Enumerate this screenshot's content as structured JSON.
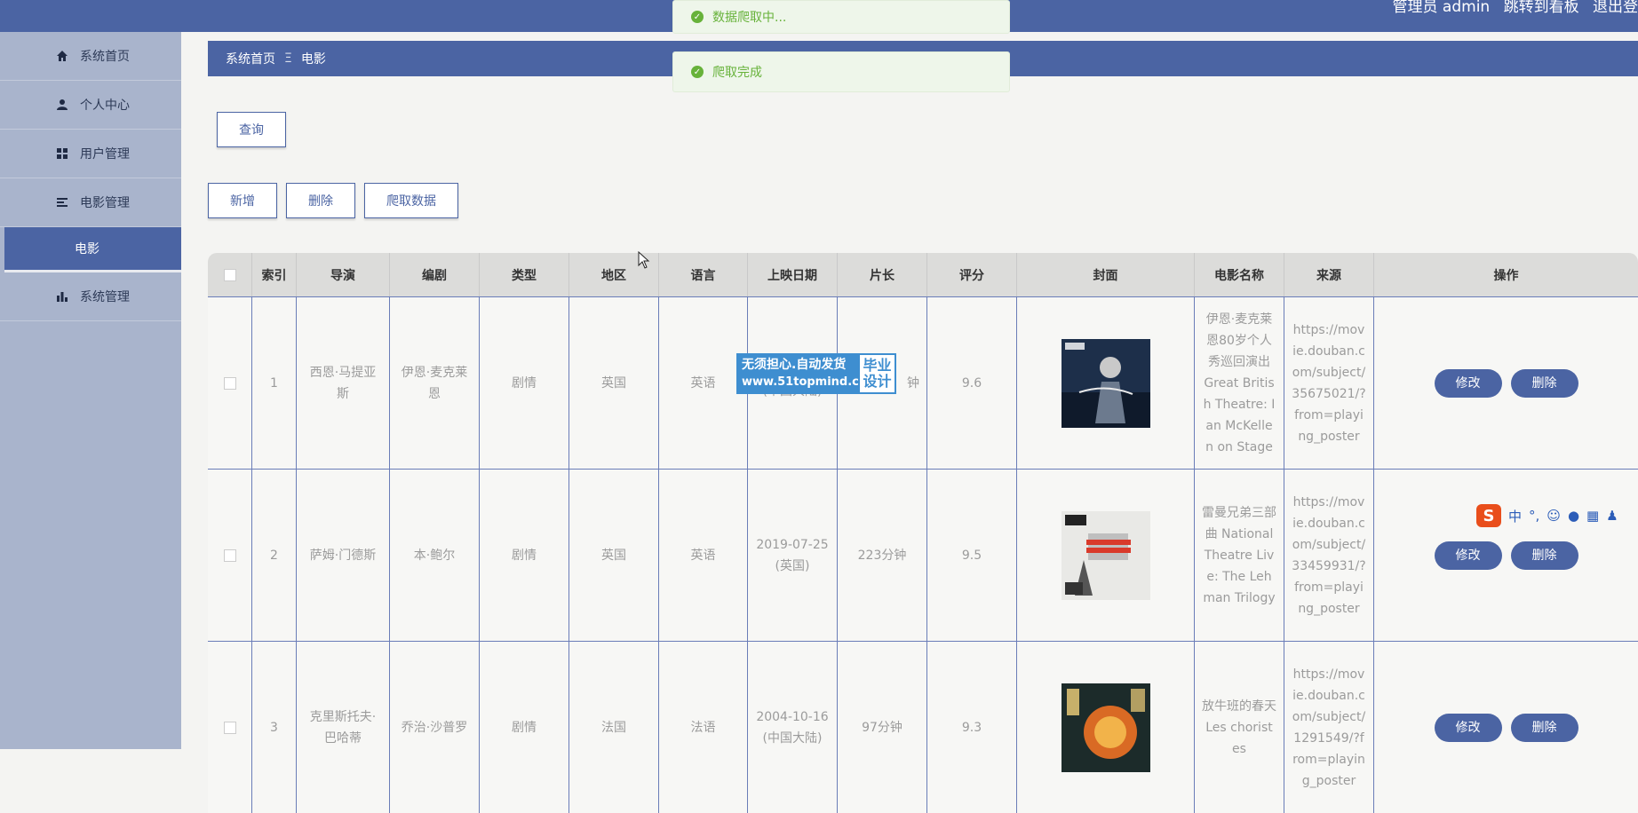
{
  "header": {
    "admin_label": "管理员 admin",
    "board_link": "跳转到看板",
    "logout_link": "退出登"
  },
  "sidebar": {
    "items": [
      {
        "label": "系统首页",
        "icon": "home-icon"
      },
      {
        "label": "个人中心",
        "icon": "user-icon"
      },
      {
        "label": "用户管理",
        "icon": "grid-icon"
      },
      {
        "label": "电影管理",
        "icon": "menu-icon"
      }
    ],
    "sub_item": "电影",
    "last_item": {
      "label": "系统管理",
      "icon": "bar-chart-icon"
    }
  },
  "breadcrumb": {
    "home": "系统首页",
    "separator": "Ξ",
    "current": "电影"
  },
  "toolbar": {
    "query": "查询",
    "add": "新增",
    "delete": "删除",
    "crawl": "爬取数据"
  },
  "toasts": {
    "crawling": "数据爬取中...",
    "done": "爬取完成"
  },
  "table": {
    "headers": [
      "索引",
      "导演",
      "编剧",
      "类型",
      "地区",
      "语言",
      "上映日期",
      "片长",
      "评分",
      "封面",
      "电影名称",
      "来源",
      "操作"
    ],
    "rows": [
      {
        "index": "1",
        "director": "西恩·马提亚斯",
        "writer": "伊恩·麦克莱恩",
        "genre": "剧情",
        "region": "英国",
        "language": "英语",
        "release": "(中国大陆)",
        "length": "钟",
        "rating": "9.6",
        "title": "伊恩·麦克莱恩80岁个人秀巡回演出 Great British Theatre: Ian McKellen on Stage",
        "source": "https://movie.douban.com/subject/35675021/?from=playing_poster"
      },
      {
        "index": "2",
        "director": "萨姆·门德斯",
        "writer": "本·鲍尔",
        "genre": "剧情",
        "region": "英国",
        "language": "英语",
        "release": "2019-07-25 (英国)",
        "length": "223分钟",
        "rating": "9.5",
        "title": "雷曼兄弟三部曲 National Theatre Live: The Lehman Trilogy",
        "source": "https://movie.douban.com/subject/33459931/?from=playing_poster"
      },
      {
        "index": "3",
        "director": "克里斯托夫·巴哈蒂",
        "writer": "乔治·沙普罗",
        "genre": "剧情",
        "region": "法国",
        "language": "法语",
        "release": "2004-10-16 (中国大陆)",
        "length": "97分钟",
        "rating": "9.3",
        "title": "放牛班的春天 Les choristes",
        "source": "https://movie.douban.com/subject/1291549/?from=playing_poster"
      }
    ],
    "edit_label": "修改",
    "delete_label": "删除"
  },
  "watermark": {
    "line1": "无须担心.自动发货",
    "url": "www.51topmind.com",
    "badge1": "毕业",
    "badge2": "设计"
  },
  "ime_toolbar": {
    "label": "中"
  },
  "colors": {
    "primary": "#4b64a3",
    "sidebar": "#a9b4cc",
    "success": "#67b23a"
  }
}
